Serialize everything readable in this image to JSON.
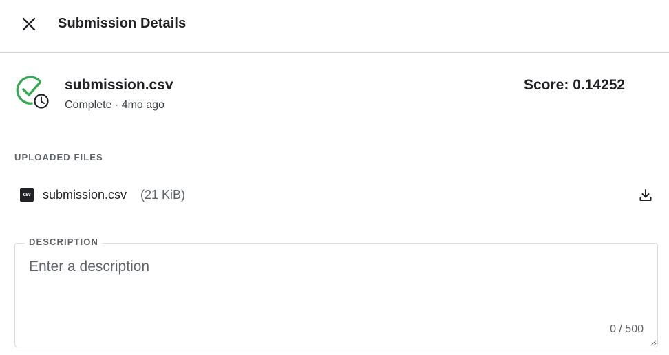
{
  "header": {
    "title": "Submission Details",
    "close_icon": "close-icon"
  },
  "submission": {
    "file_name": "submission.csv",
    "status": "Complete · 4mo ago",
    "score": "Score: 0.14252",
    "status_icon": "check-circle-clock-icon",
    "success_color": "#34a853"
  },
  "uploaded_files": {
    "label": "UPLOADED FILES",
    "files": [
      {
        "name": "submission.csv",
        "size": "(21 KiB)",
        "type_badge": "CSV",
        "icon": "csv-file-icon",
        "action_icon": "download-icon"
      }
    ]
  },
  "description": {
    "label": "DESCRIPTION",
    "placeholder": "Enter a description",
    "value": "",
    "char_count": "0 / 500"
  }
}
